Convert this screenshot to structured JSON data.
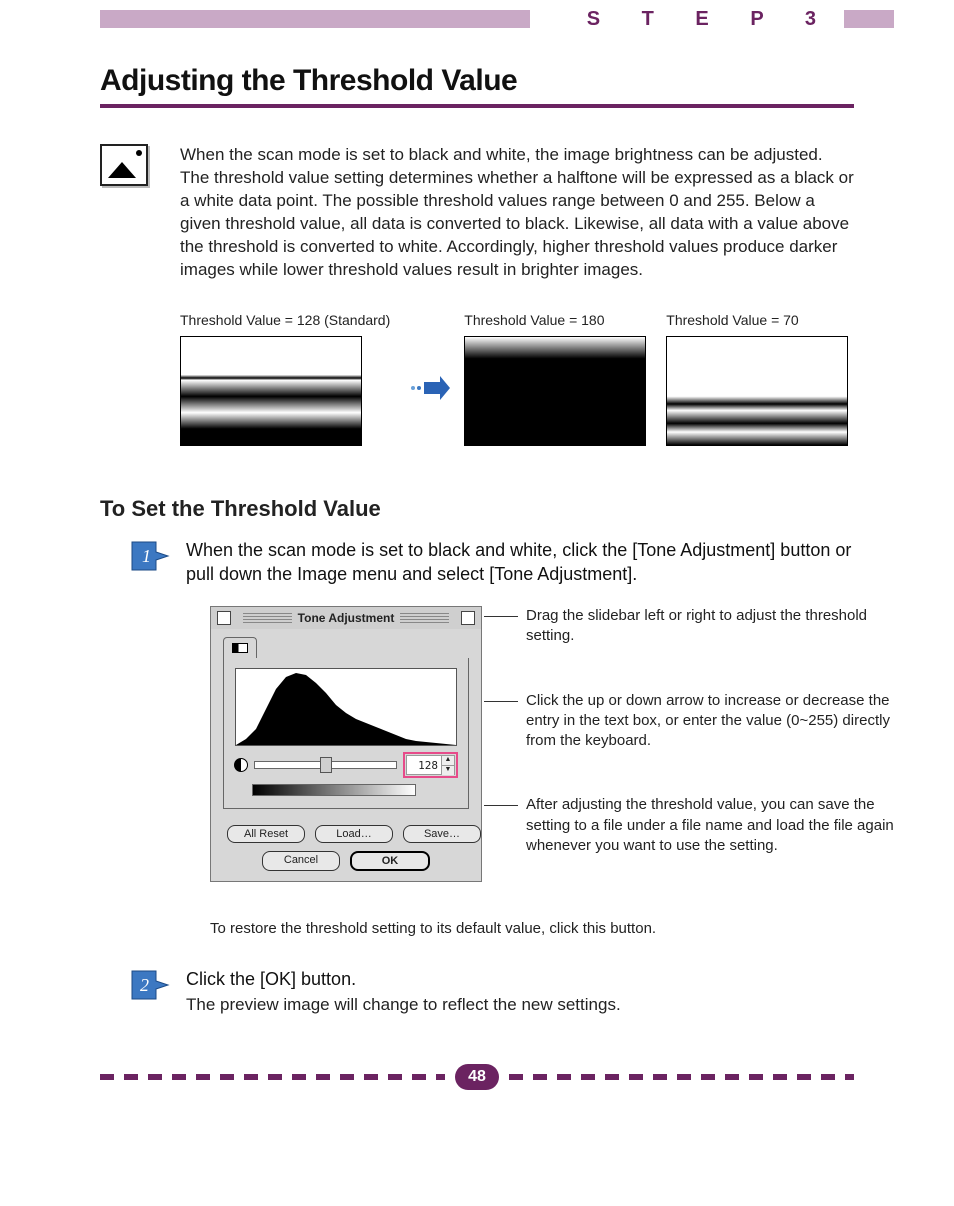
{
  "header": {
    "step_label": "S T E P   3"
  },
  "title": "Adjusting the Threshold Value",
  "intro_paragraph": "When the scan mode is set to black and white, the image brightness can be adjusted. The threshold value setting determines whether a halftone will be expressed as a black or a white data point. The possible threshold values range between 0 and 255. Below a given threshold value, all data is converted to black. Likewise, all data with a value above the threshold is converted to white. Accordingly, higher threshold values produce darker images while lower threshold values result in brighter images.",
  "examples": {
    "caption_a": "Threshold Value = 128 (Standard)",
    "caption_b": "Threshold Value = 180",
    "caption_c": "Threshold Value = 70"
  },
  "subheading": "To Set the Threshold Value",
  "steps": {
    "step1_number": "1",
    "step1_text": "When the scan mode is set to black and white, click the [Tone Adjustment] button or pull down the Image menu and select [Tone Adjustment].",
    "step2_number": "2",
    "step2_title": "Click the [OK] button.",
    "step2_sub": "The preview image will change to reflect the new settings."
  },
  "callouts": {
    "slider_note": "Drag the slidebar left or right to adjust the threshold setting.",
    "value_note": "Click the up or down arrow to increase or decrease the entry in the text box, or enter the value (0~255) directly from the keyboard.",
    "save_note": "After adjusting the threshold value, you can save the setting to a file under a file name and load the file again whenever you want to use the setting.",
    "reset_note": "To restore the threshold setting to its default value, click this button."
  },
  "dialog": {
    "title": "Tone Adjustment",
    "value": "128",
    "buttons": {
      "all_reset": "All Reset",
      "load": "Load…",
      "save": "Save…",
      "cancel": "Cancel",
      "ok": "OK"
    }
  },
  "page_number": "48"
}
